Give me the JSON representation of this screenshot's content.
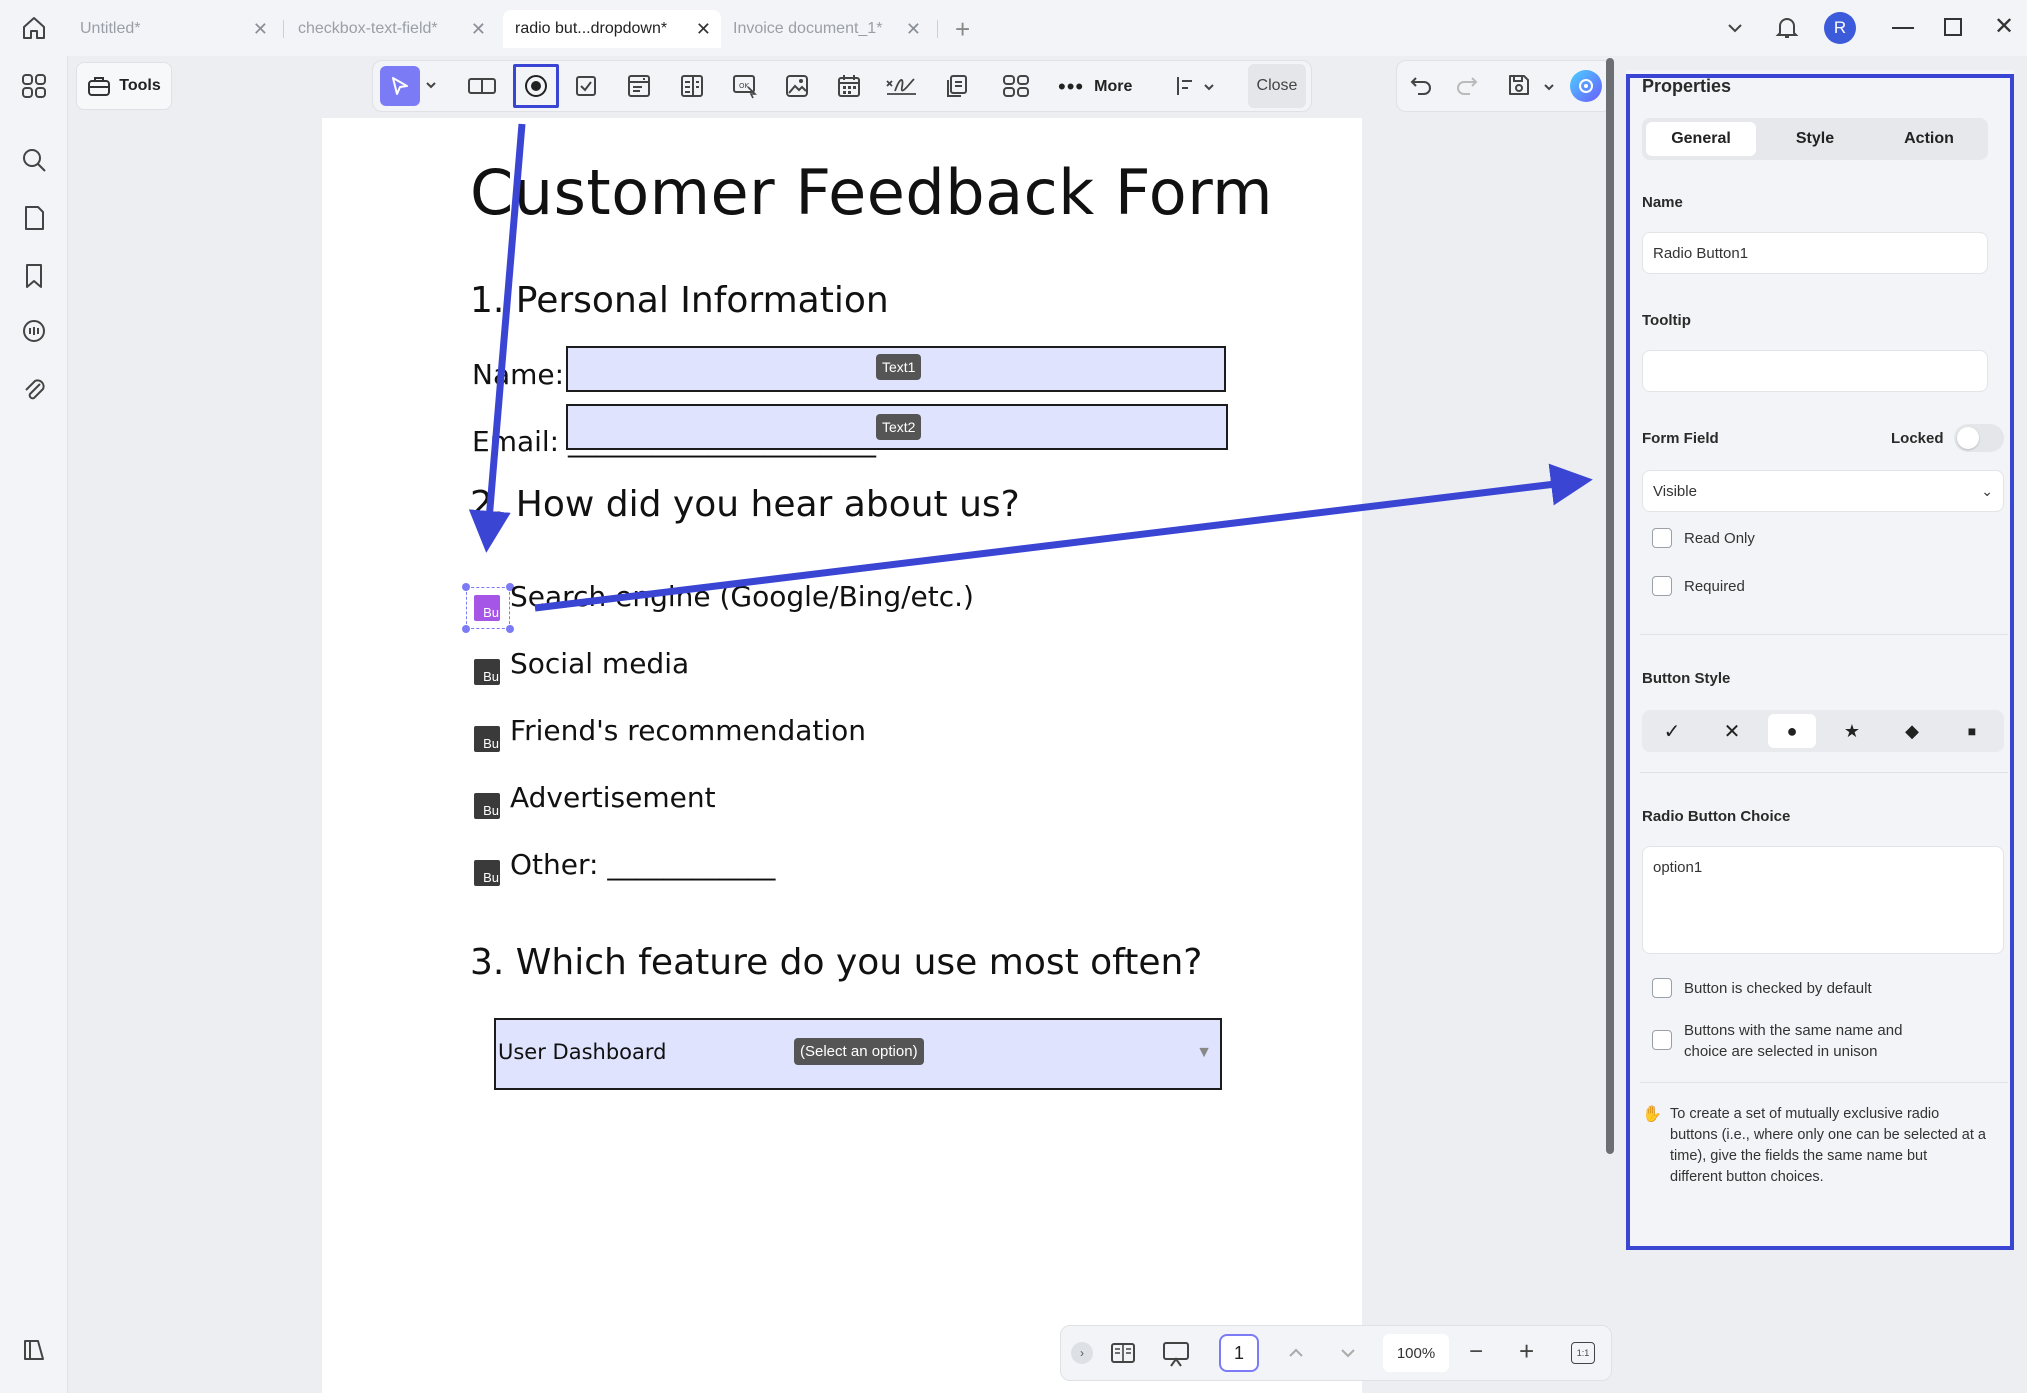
{
  "tabs": [
    {
      "label": "Untitled*",
      "active": false
    },
    {
      "label": "checkbox-text-field*",
      "active": false
    },
    {
      "label": "radio but...dropdown*",
      "active": true
    },
    {
      "label": "Invoice document_1*",
      "active": false
    }
  ],
  "window": {
    "avatar_initial": "R"
  },
  "toolbar": {
    "tools_label": "Tools",
    "more_label": "More",
    "close_label": "Close",
    "accent": "#7b7bf5",
    "highlight": "#3b45d4"
  },
  "document": {
    "title": "Customer Feedback Form",
    "section1": "1. Personal Information",
    "name_label": "Name: _",
    "name_field_tag": "Text1",
    "email_label": "Email: ______________________",
    "email_field_tag": "Text2",
    "section2": "2. How did you hear about us?",
    "radio_tag": "Bu",
    "options": [
      "Search engine (Google/Bing/etc.)",
      "Social media",
      "Friend's recommendation",
      "Advertisement",
      "Other: ____________"
    ],
    "section3": "3. Which feature do you use most often?",
    "dropdown_value": "User Dashboard",
    "dropdown_tag": "(Select an option)"
  },
  "properties": {
    "title": "Properties",
    "tabs": [
      "General",
      "Style",
      "Action"
    ],
    "active_tab": "General",
    "name_label": "Name",
    "name_value": "Radio Button1",
    "tooltip_label": "Tooltip",
    "tooltip_value": "",
    "form_field_label": "Form Field",
    "locked_label": "Locked",
    "visibility_value": "Visible",
    "read_only_label": "Read Only",
    "required_label": "Required",
    "button_style_label": "Button Style",
    "button_styles": [
      "check",
      "cross",
      "circle",
      "star",
      "diamond",
      "square"
    ],
    "selected_style": "circle",
    "choice_label": "Radio Button Choice",
    "choice_value": "option1",
    "checked_default_label": "Button is checked by default",
    "unison_label_1": "Buttons with the same name and",
    "unison_label_2": "choice are selected in unison",
    "hint_1": "To create a set of mutually exclusive radio",
    "hint_2": "buttons (i.e., where only one can be selected at a",
    "hint_3": "time), give the fields the same name but",
    "hint_4": "different button choices."
  },
  "bottom": {
    "page_number": "1",
    "zoom": "100%"
  }
}
